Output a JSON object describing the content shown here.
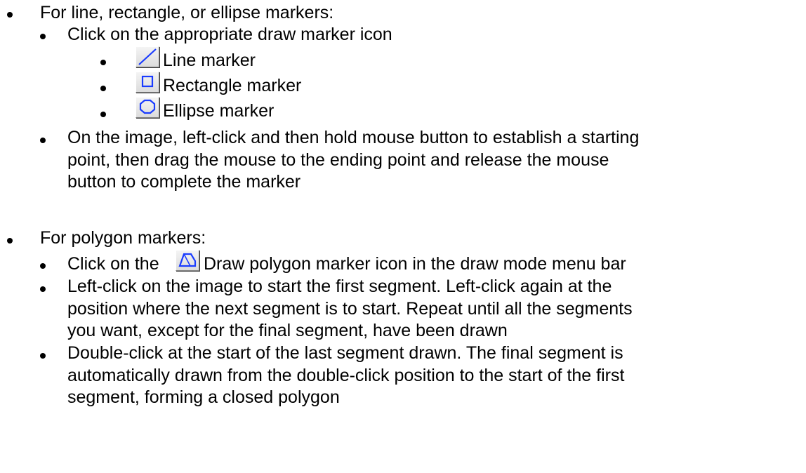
{
  "sections": {
    "shapes": {
      "heading": "For line, rectangle, or ellipse markers:",
      "step1": "Click on the appropriate draw marker icon",
      "tools": [
        {
          "label": "Line marker",
          "icon": "line-marker-icon"
        },
        {
          "label": "Rectangle marker",
          "icon": "rectangle-marker-icon"
        },
        {
          "label": "Ellipse marker",
          "icon": "ellipse-marker-icon"
        }
      ],
      "step2": {
        "line1": "On the image, left-click and then hold mouse button to establish a starting",
        "line2": "point, then drag the mouse to the ending point and release the mouse",
        "line3": "button to complete the marker"
      }
    },
    "polygon": {
      "heading": "For polygon markers:",
      "step1": {
        "prefix": "Click on the",
        "suffix": "Draw polygon marker icon in the draw mode menu bar",
        "icon": "polygon-marker-icon"
      },
      "step2": {
        "line1": "Left-click on the image to start the first segment. Left-click again at the",
        "line2": "position where the next segment is to start. Repeat until all the segments",
        "line3": "you want, except for the final segment, have been drawn"
      },
      "step3": {
        "line1": "Double-click at the start of the last segment drawn. The final segment is",
        "line2": "automatically drawn from the double-click position to the start of the first",
        "line3": "segment, forming a closed polygon"
      }
    }
  },
  "colors": {
    "icon_stroke": "#1a3cff",
    "text": "#000000"
  }
}
